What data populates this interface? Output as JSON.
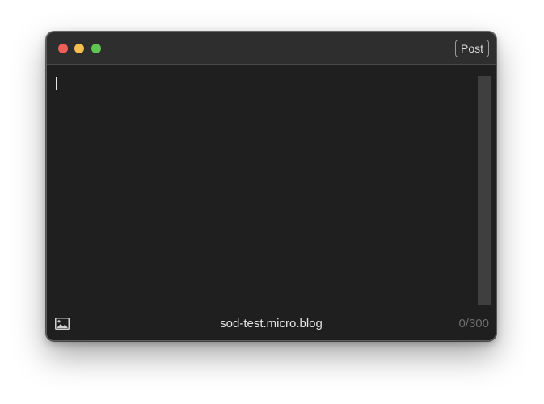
{
  "window": {
    "controls": {
      "close_color": "#ee5f57",
      "minimize_color": "#f5bf4f",
      "zoom_color": "#60c653"
    },
    "post_button_label": "Post"
  },
  "editor": {
    "text": ""
  },
  "footer": {
    "photo_icon": "photo-icon",
    "account_name": "sod-test.micro.blog",
    "char_count": "0/300"
  }
}
